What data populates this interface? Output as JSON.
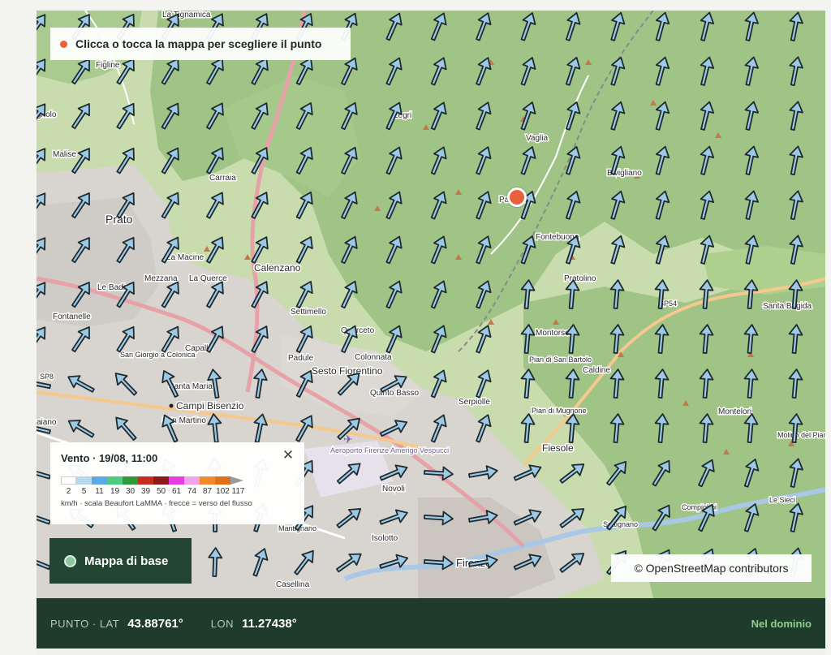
{
  "map": {
    "hint": "Clicca o tocca la mappa per scegliere il punto",
    "attribution": "© OpenStreetMap contributors",
    "basemap_button": "Mappa di base",
    "places": [
      {
        "name": "La Tignamica",
        "id": "la-tignamica"
      },
      {
        "name": "Figline",
        "id": "figline"
      },
      {
        "name": "gnolo",
        "id": "gnolo"
      },
      {
        "name": "Legri",
        "id": "legri"
      },
      {
        "name": "Vaglia",
        "id": "vaglia"
      },
      {
        "name": "Malise",
        "id": "malise"
      },
      {
        "name": "Carraia",
        "id": "carraia"
      },
      {
        "name": "Bivigliano",
        "id": "bivigliano"
      },
      {
        "name": "Paterno",
        "id": "paterno"
      },
      {
        "name": "Prato",
        "id": "prato"
      },
      {
        "name": "Fontebuona",
        "id": "fontebuona"
      },
      {
        "name": "La Macine",
        "id": "la-macine"
      },
      {
        "name": "Calenzano",
        "id": "calenzano"
      },
      {
        "name": "Le Badie",
        "id": "le-badie"
      },
      {
        "name": "Mezzana",
        "id": "mezzana"
      },
      {
        "name": "La Querce",
        "id": "la-querce"
      },
      {
        "name": "Pratolino",
        "id": "pratolino"
      },
      {
        "name": "SP54",
        "id": "sp54"
      },
      {
        "name": "Fontanelle",
        "id": "fontanelle"
      },
      {
        "name": "Settimello",
        "id": "settimello"
      },
      {
        "name": "Santa Brigida",
        "id": "santa-brigida"
      },
      {
        "name": "Querceto",
        "id": "querceto"
      },
      {
        "name": "Montorsoli",
        "id": "montorsoli"
      },
      {
        "name": "Capalle",
        "id": "capalle"
      },
      {
        "name": "San Giorgio a Colonica",
        "id": "san-giorgio"
      },
      {
        "name": "Padule",
        "id": "padule"
      },
      {
        "name": "Colonnata",
        "id": "colonnata"
      },
      {
        "name": "Pian di San Bartolo",
        "id": "pian-di-san-bartolo"
      },
      {
        "name": "Caldine",
        "id": "caldine"
      },
      {
        "name": "SP8",
        "id": "sp8"
      },
      {
        "name": "Sesto Fiorentino",
        "id": "sesto-fiorentino"
      },
      {
        "name": "Santa Maria",
        "id": "santa-maria"
      },
      {
        "name": "Quinto Basso",
        "id": "quinto-basso"
      },
      {
        "name": "Campi Bisenzio",
        "id": "campi-bisenzio"
      },
      {
        "name": "Serpiolle",
        "id": "serpiolle"
      },
      {
        "name": "Pian di Mugnone",
        "id": "pian-di-mugnone"
      },
      {
        "name": "Montelori",
        "id": "montelori"
      },
      {
        "name": "aiano",
        "id": "aiano"
      },
      {
        "name": "San Martino",
        "id": "san-martino"
      },
      {
        "name": "Molino del Piano",
        "id": "molino-del-piano"
      },
      {
        "name": "Aeroporto Firenze Amerigo Vespucci",
        "id": "aeroporto"
      },
      {
        "name": "Fiesole",
        "id": "fiesole"
      },
      {
        "name": "Novoli",
        "id": "novoli"
      },
      {
        "name": "Le Sieci",
        "id": "le-sieci"
      },
      {
        "name": "Compiobbi",
        "id": "compiobbi"
      },
      {
        "name": "Settignano",
        "id": "settignano"
      },
      {
        "name": "Isolotto",
        "id": "isolotto"
      },
      {
        "name": "Firenze",
        "id": "firenze"
      },
      {
        "name": "Casellina",
        "id": "casellina"
      },
      {
        "name": "Mantignano",
        "id": "mantignano"
      }
    ]
  },
  "legend": {
    "title": "Vento · 19/08, 11:00",
    "close_glyph": "✕",
    "scale": [
      {
        "label": "2",
        "color": "#ffffff"
      },
      {
        "label": "5",
        "color": "#b9d8ec"
      },
      {
        "label": "11",
        "color": "#5ea8e7"
      },
      {
        "label": "19",
        "color": "#4fca83"
      },
      {
        "label": "30",
        "color": "#2f9a3c"
      },
      {
        "label": "39",
        "color": "#c52f1f"
      },
      {
        "label": "50",
        "color": "#8b1a1a"
      },
      {
        "label": "61",
        "color": "#e53de0"
      },
      {
        "label": "74",
        "color": "#f3a3e8"
      },
      {
        "label": "87",
        "color": "#f08a2c"
      },
      {
        "label": "102",
        "color": "#e0701f"
      },
      {
        "label": "117",
        "color": "#9a9a9a"
      }
    ],
    "unit_text": "km/h · scala Beaufort LaMMA · frecce = verso del flusso"
  },
  "footer": {
    "lat_label": "PUNTO · LAT",
    "lat_value": "43.88761°",
    "lon_label": "LON",
    "lon_value": "11.27438°",
    "status": "Nel dominio"
  },
  "colors": {
    "arrow_fill": "#9cc9e3",
    "arrow_stroke": "#1f2a30",
    "marker": "#e8613a",
    "footer_bg": "#1f3b2c",
    "forest": "#9fc486",
    "urban": "#d8d4cf"
  }
}
